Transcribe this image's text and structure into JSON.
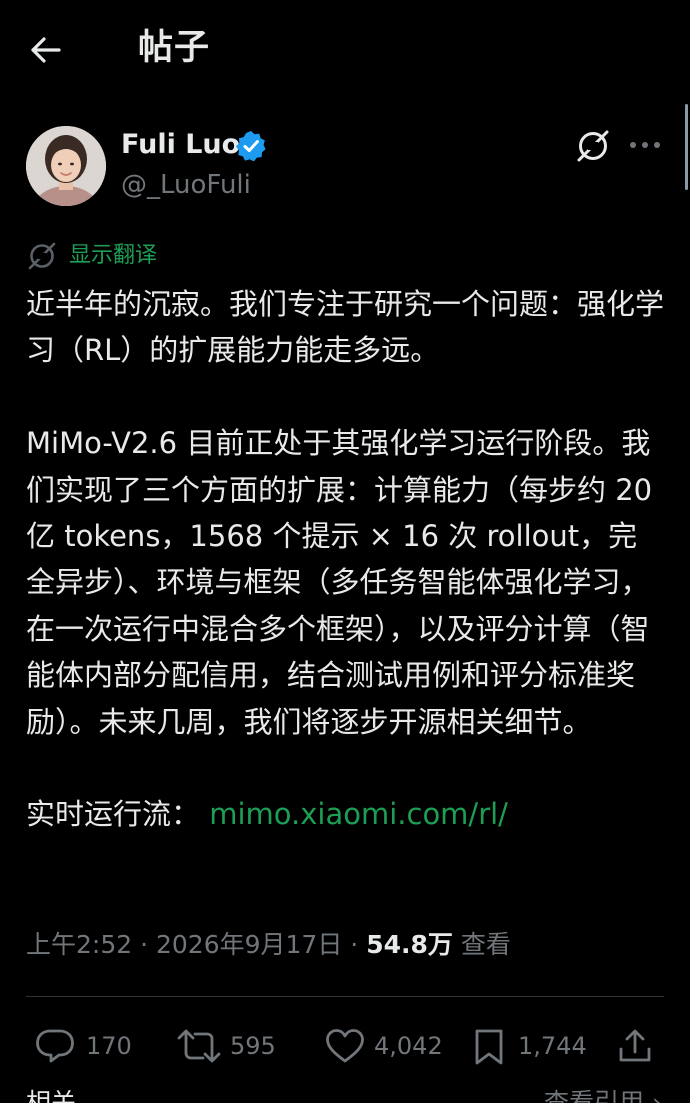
{
  "header": {
    "title": "帖子",
    "back_icon": "arrow-left-icon"
  },
  "author": {
    "name": "Fuli Luo",
    "handle": "@_LuoFuli",
    "verified": true,
    "verified_color": "#1d9bf0"
  },
  "translate": {
    "label": "显示翻译",
    "icon": "grok-icon"
  },
  "post": {
    "paragraph_1": "近半年的沉寂。我们专注于研究一个问题：强化学习（RL）的扩展能力能走多远。",
    "paragraph_2": "MiMo-V2.6 目前正处于其强化学习运行阶段。我们实现了三个方面的扩展：计算能力（每步约 20 亿 tokens，1568 个提示 × 16 次 rollout，完全异步）、环境与框架（多任务智能体强化学习，在一次运行中混合多个框架），以及评分计算（智能体内部分配信用，结合测试用例和评分标准奖励）。未来几周，我们将逐步开源相关细节。",
    "stream_label": "实时运行流：",
    "stream_link": "mimo.xiaomi.com/rl/"
  },
  "meta": {
    "time": "上午2:52",
    "separator": "·",
    "date": "2026年9月17日",
    "views_count": "54.8万",
    "views_label": "查看"
  },
  "actions": {
    "replies": "170",
    "reposts": "595",
    "likes": "4,042",
    "bookmarks": "1,744"
  },
  "footer": {
    "related_label": "相关",
    "quotes_label": "查看引用 ›"
  },
  "colors": {
    "background": "#000000",
    "text": "#e7e9ea",
    "muted": "#71767b",
    "link": "#1d9e55",
    "divider": "#2f3336"
  }
}
